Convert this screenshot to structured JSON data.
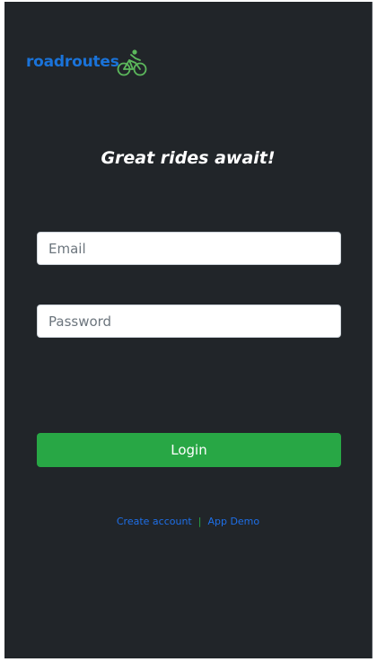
{
  "brand": {
    "name": "roadroutes",
    "icon": "cyclist-icon",
    "text_color": "#1a73d9",
    "icon_color": "#5cb85c"
  },
  "tagline": "Great rides await!",
  "form": {
    "email_placeholder": "Email",
    "password_placeholder": "Password",
    "login_label": "Login"
  },
  "footer": {
    "create_account": "Create account",
    "separator": "|",
    "app_demo": "App Demo"
  },
  "colors": {
    "background": "#212529",
    "primary_button": "#28a745",
    "link": "#1e6fe8"
  }
}
